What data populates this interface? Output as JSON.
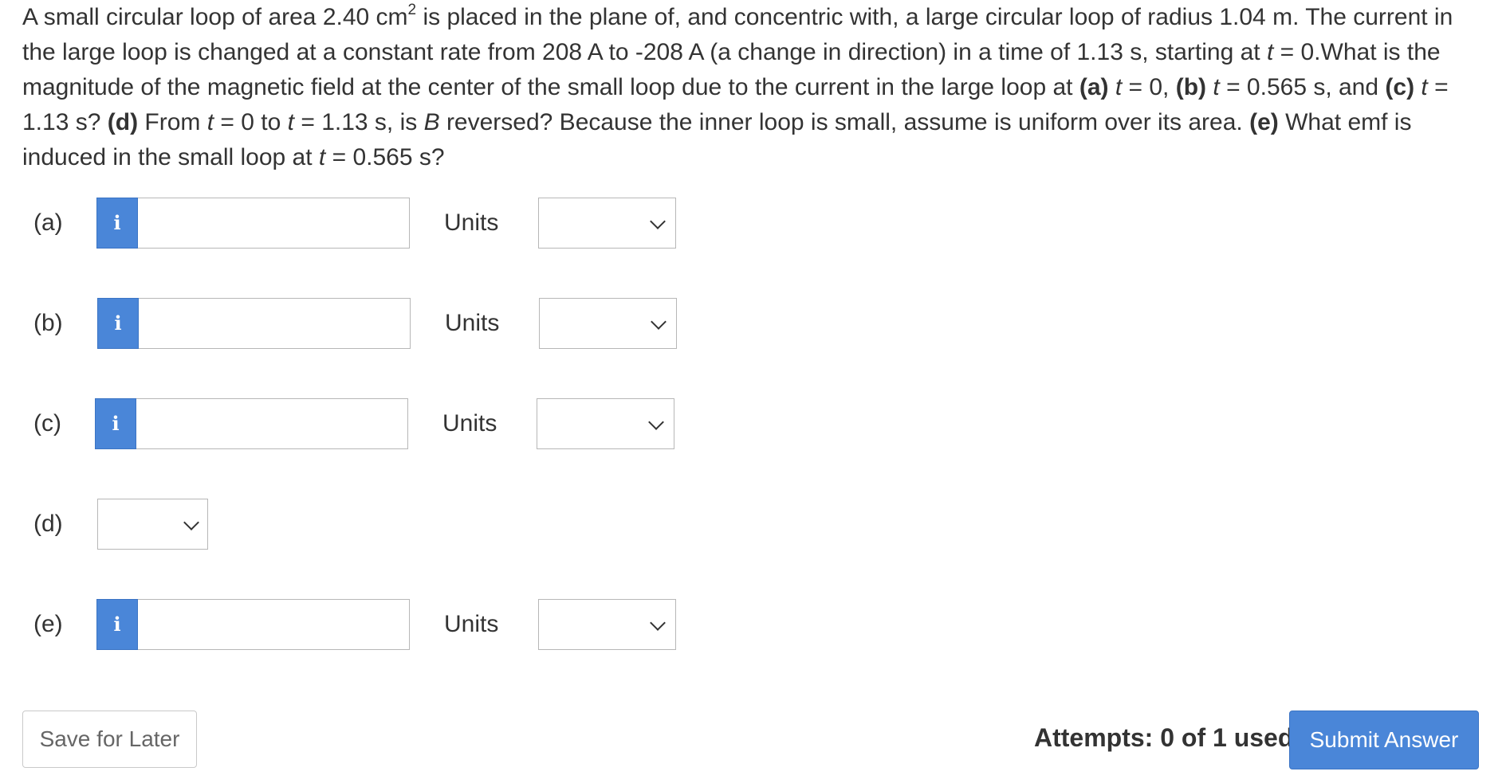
{
  "question": {
    "s1": "A small circular loop of area 2.40 cm",
    "s1_sup": "2",
    "s2": " is placed in the plane of, and concentric with, a large circular loop of radius 1.04 m. The current in the large loop is changed at a constant rate from 208 A to -208 A (a change in direction) in a time of 1.13 s, starting at ",
    "t_var": "t",
    "s3": " = 0.What is the magnitude of the magnetic field at the center of the small loop due to the current in the large loop at ",
    "a_label": "(a)",
    "s4": " = 0, ",
    "b_label": "(b)",
    "s5": " = 0.565 s, and ",
    "c_label": "(c)",
    "s6": " = 1.13 s? ",
    "d_label": "(d)",
    "s7": " From ",
    "s8": " = 0 to ",
    "s9": " = 1.13 s, is ",
    "b_var": "B",
    "s10": " reversed? Because the inner loop is small, assume is uniform over its area. ",
    "e_label": "(e)",
    "s11": " What emf is induced in the small loop at ",
    "s12": " = 0.565 s?"
  },
  "parts": [
    {
      "label": "(a)",
      "value": "",
      "units_label": "Units",
      "units_value": ""
    },
    {
      "label": "(b)",
      "value": "",
      "units_label": "Units",
      "units_value": ""
    },
    {
      "label": "(c)",
      "value": "",
      "units_label": "Units",
      "units_value": ""
    },
    {
      "label": "(d)",
      "select_value": ""
    },
    {
      "label": "(e)",
      "value": "",
      "units_label": "Units",
      "units_value": ""
    }
  ],
  "info_icon_glyph": "i",
  "footer": {
    "save_label": "Save for Later",
    "attempts_text": "Attempts: 0 of 1 used",
    "submit_label": "Submit Answer"
  },
  "colors": {
    "accent": "#4a86d8",
    "text": "#333333",
    "border": "#b7b7b7"
  },
  "icons": [
    "info-icon",
    "chevron-down-icon"
  ]
}
